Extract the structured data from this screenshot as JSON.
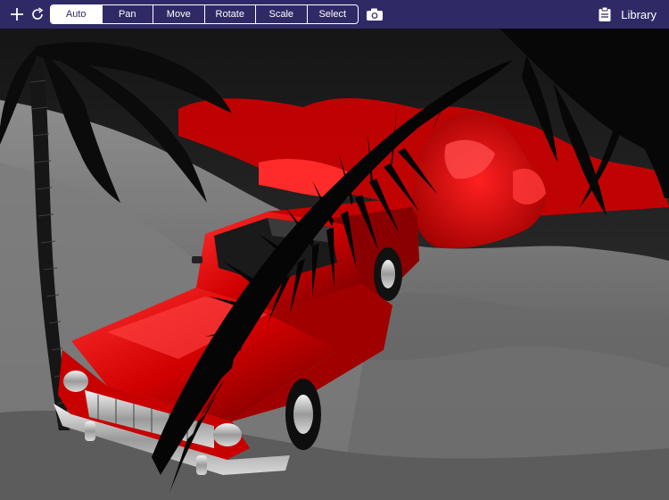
{
  "toolbar": {
    "modes": [
      {
        "label": "Auto",
        "active": true
      },
      {
        "label": "Pan",
        "active": false
      },
      {
        "label": "Move",
        "active": false
      },
      {
        "label": "Rotate",
        "active": false
      },
      {
        "label": "Scale",
        "active": false
      },
      {
        "label": "Select",
        "active": false
      }
    ],
    "library_label": "Library",
    "icons": {
      "add": "plus-icon",
      "refresh": "refresh-icon",
      "camera": "camera-icon",
      "library": "clipboard-icon"
    }
  },
  "colors": {
    "toolbar_bg": "#2f2a66",
    "accent_red": "#e00000"
  }
}
